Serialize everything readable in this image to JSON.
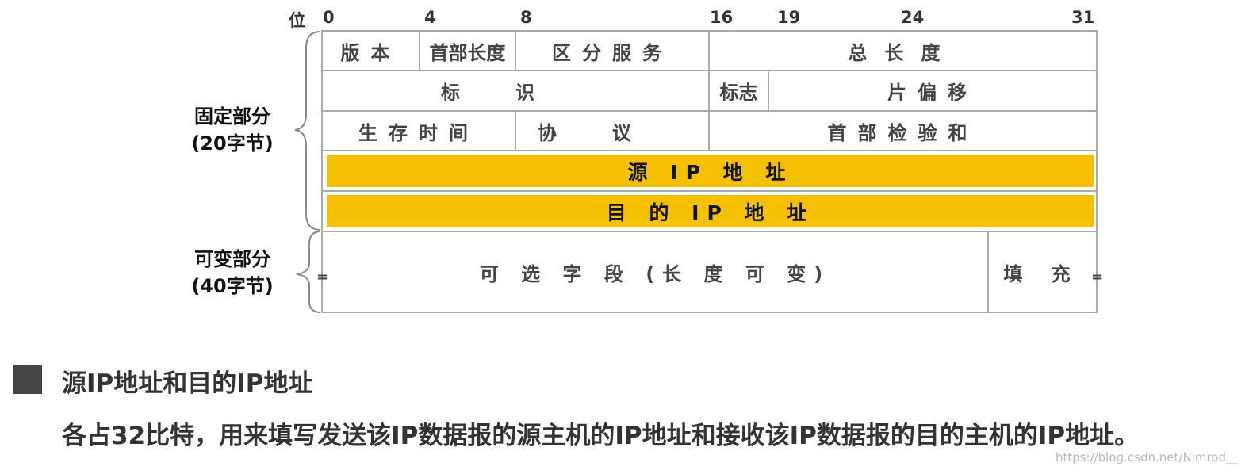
{
  "bit_axis": {
    "label": "位",
    "ticks": [
      "0",
      "4",
      "8",
      "16",
      "19",
      "24",
      "31"
    ]
  },
  "header": {
    "rows": [
      [
        "版本",
        "首部长度",
        "区分服务",
        "总长度"
      ],
      [
        "标识",
        "标志",
        "片偏移"
      ],
      [
        "生存时间",
        "协议",
        "首部检验和"
      ]
    ],
    "source_ip": "源 IP 地 址",
    "dest_ip": "目 的 IP 地 址",
    "options": "可 选 字 段 (长 度 可 变)",
    "padding": "填 充"
  },
  "side_labels": {
    "fixed": [
      "固定部分",
      "(20字节)"
    ],
    "variable": [
      "可变部分",
      "(40字节)"
    ]
  },
  "section": {
    "heading": "源IP地址和目的IP地址",
    "description": "各占32比特，用来填写发送该IP数据报的源主机的IP地址和接收该IP数据报的目的主机的IP地址。"
  },
  "watermark": "https://blog.csdn.net/Nimrod__",
  "colors": {
    "highlight": "#f5c000",
    "grid": "#a9a9a9"
  }
}
